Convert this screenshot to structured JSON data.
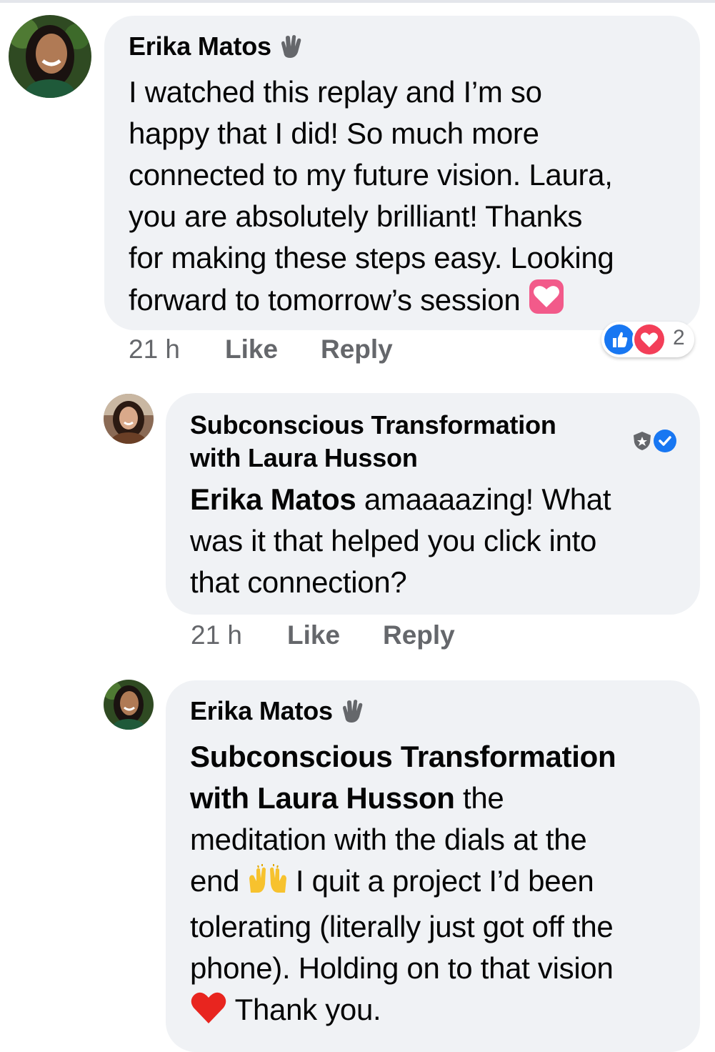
{
  "comment1": {
    "author": "Erika Matos",
    "badge_icon": "waving-hand-icon",
    "text_lines": [
      "I watched this replay and I’m so",
      "happy that I did! So much more",
      "connected to my future vision. Laura,",
      "you are absolutely brilliant! Thanks",
      "for making these steps easy. Looking",
      "forward to tomorrow’s session"
    ],
    "emoji_icon": "pink-heart-emoji",
    "time": "21 h",
    "like_label": "Like",
    "reply_label": "Reply",
    "reactions": {
      "icons": [
        "like-reaction-icon",
        "love-reaction-icon"
      ],
      "count": "2"
    }
  },
  "comment2": {
    "author_line1": "Subconscious Transformation",
    "author_line2": "with Laura Husson",
    "badge_icons": [
      "admin-shield-icon",
      "verified-check-icon"
    ],
    "mention": "Erika Matos",
    "line1_rest": " amaaaazing! What",
    "line2": "was it that helped you click into",
    "line3": "that connection?",
    "time": "21 h",
    "like_label": "Like",
    "reply_label": "Reply"
  },
  "comment3": {
    "author": "Erika Matos",
    "badge_icon": "waving-hand-icon",
    "mention_line1": "Subconscious Transformation",
    "mention_line2": "with Laura Husson",
    "line2_rest": " the",
    "line3": "meditation with the dials at the",
    "line4_a": "end",
    "raised-hands_icon": "raising-hands-emoji",
    "line4_b": " I quit a project I’d been",
    "line5": "tolerating (literally just got off the",
    "line6": "phone). Holding on to that vision",
    "heart_icon": "red-heart-emoji",
    "line7": " Thank you."
  },
  "colors": {
    "bubble": "#f0f2f5",
    "meta_text": "#65676b",
    "like_blue": "#1877f2",
    "love_red": "#f33e58",
    "text": "#050505"
  }
}
